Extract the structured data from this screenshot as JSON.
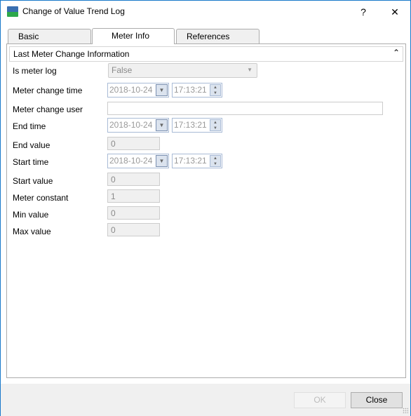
{
  "window": {
    "title": "Change of Value Trend Log",
    "help": "?",
    "close": "✕"
  },
  "tabs": [
    {
      "label": "Basic"
    },
    {
      "label": "Meter Info",
      "active": true
    },
    {
      "label": "References"
    }
  ],
  "section": {
    "title": "Last Meter Change Information",
    "chevron": "⌃"
  },
  "fields": {
    "is_meter_log": {
      "label": "Is meter log",
      "value": "False"
    },
    "meter_change_time": {
      "label": "Meter change time",
      "date": "2018-10-24",
      "time": "17:13:21"
    },
    "meter_change_user": {
      "label": "Meter change user",
      "value": ""
    },
    "end_time": {
      "label": "End time",
      "date": "2018-10-24",
      "time": "17:13:21"
    },
    "end_value": {
      "label": "End value",
      "value": "0"
    },
    "start_time": {
      "label": "Start time",
      "date": "2018-10-24",
      "time": "17:13:21"
    },
    "start_value": {
      "label": "Start value",
      "value": "0"
    },
    "meter_constant": {
      "label": "Meter constant",
      "value": "1"
    },
    "min_value": {
      "label": "Min value",
      "value": "0"
    },
    "max_value": {
      "label": "Max value",
      "value": "0"
    }
  },
  "footer": {
    "ok": "OK",
    "close": "Close"
  }
}
